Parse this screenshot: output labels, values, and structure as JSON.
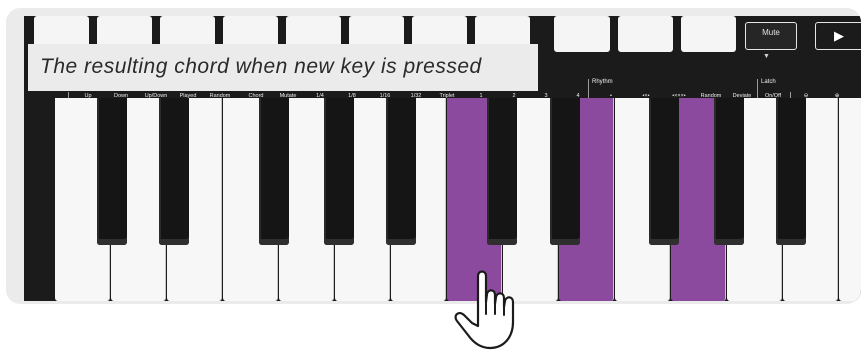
{
  "caption": "The resulting chord when new key is pressed",
  "mute_label": "Mute",
  "play_symbol": "▶",
  "arrow_symbol": "▼",
  "function_labels": [
    "Up",
    "Down",
    "Up/Down",
    "Played",
    "Random",
    "Chord",
    "Mutate",
    "1/4",
    "1/8",
    "1/16",
    "1/32",
    "Triplet",
    "1",
    "2",
    "3",
    "4",
    "•",
    "•×•",
    "•×××•",
    "Random",
    "Deviate",
    "On/Off",
    "⊖",
    "⊕"
  ],
  "rhythm_label": "Rhythm",
  "latch_label": "Latch",
  "pressed_keys": [
    7,
    9,
    11
  ],
  "accent_color": "#8b4a9e",
  "icons": [
    "play-icon",
    "down-arrow-icon",
    "pointing-hand-icon",
    "minus-icon",
    "plus-icon"
  ]
}
